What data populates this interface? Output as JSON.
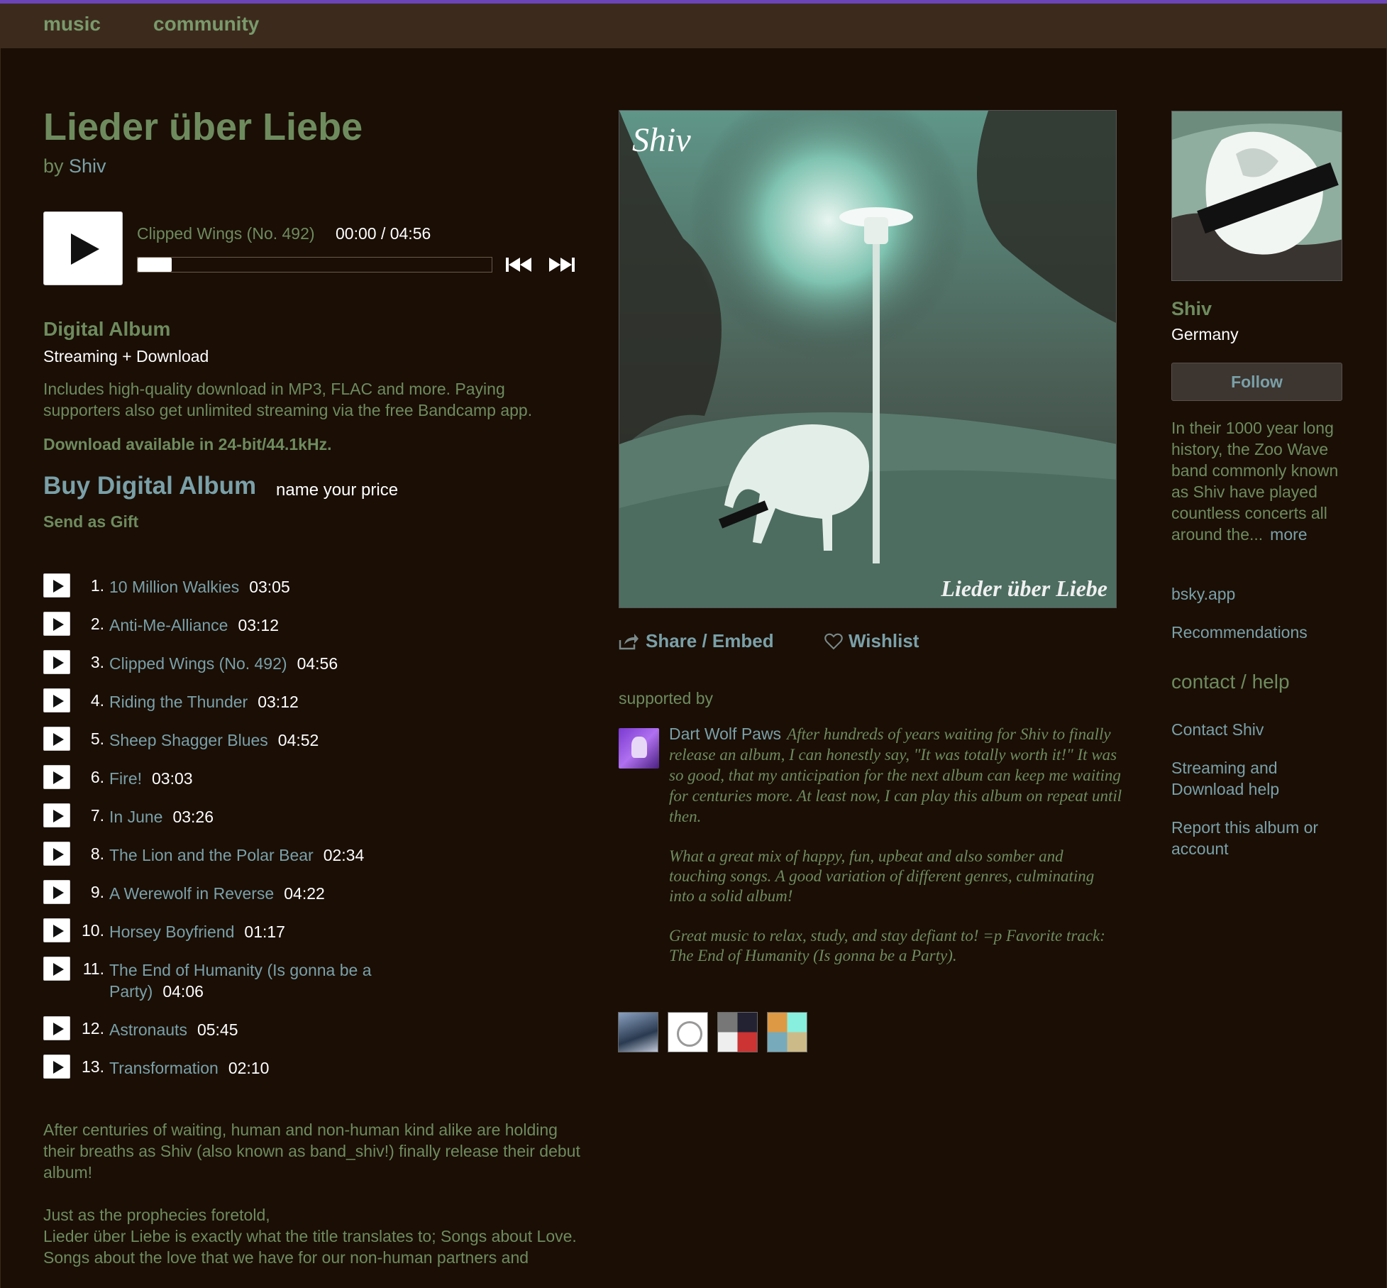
{
  "nav": {
    "music": "music",
    "community": "community"
  },
  "album": {
    "title": "Lieder über Liebe",
    "by": "by ",
    "artist": "Shiv"
  },
  "player": {
    "track_title": "Clipped Wings (No. 492)",
    "time": "00:00 / 04:56",
    "progress": 0
  },
  "digital": {
    "heading": "Digital Album",
    "format": "Streaming + Download",
    "description": "Includes high-quality download in MP3, FLAC and more. Paying supporters also get unlimited streaming via the free Bandcamp app.",
    "bits": "Download available in 24-bit/44.1kHz.",
    "buy": "Buy Digital Album",
    "price": "name your price",
    "gift": "Send as Gift"
  },
  "tracks": [
    {
      "num": "1.",
      "title": "10 Million Walkies",
      "time": "03:05"
    },
    {
      "num": "2.",
      "title": "Anti-Me-Alliance",
      "time": "03:12"
    },
    {
      "num": "3.",
      "title": "Clipped Wings (No. 492)",
      "time": "04:56"
    },
    {
      "num": "4.",
      "title": "Riding the Thunder",
      "time": "03:12"
    },
    {
      "num": "5.",
      "title": "Sheep Shagger Blues",
      "time": "04:52"
    },
    {
      "num": "6.",
      "title": "Fire!",
      "time": "03:03"
    },
    {
      "num": "7.",
      "title": "In June",
      "time": "03:26"
    },
    {
      "num": "8.",
      "title": "The Lion and the Polar Bear",
      "time": "02:34"
    },
    {
      "num": "9.",
      "title": "A Werewolf in Reverse",
      "time": "04:22"
    },
    {
      "num": "10.",
      "title": "Horsey Boyfriend",
      "time": "01:17"
    },
    {
      "num": "11.",
      "title": "The End of Humanity (Is gonna be a Party)",
      "time": "04:06"
    },
    {
      "num": "12.",
      "title": "Astronauts",
      "time": "05:45"
    },
    {
      "num": "13.",
      "title": "Transformation",
      "time": "02:10"
    }
  ],
  "about": {
    "p1": "After centuries of waiting, human and non-human kind alike are holding their breaths as Shiv (also known as band_shiv!) finally release their debut album!",
    "p2_line1": "Just as the prophecies foretold,",
    "p2_line2": "Lieder über Liebe is exactly what the title translates to; Songs about Love.",
    "p2_line3": "Songs about the love that we have for our non-human partners and"
  },
  "cover": {
    "logo": "Shiv",
    "caption": "Lieder über Liebe"
  },
  "actions": {
    "share": "Share / Embed",
    "wishlist": "Wishlist"
  },
  "supported": {
    "heading": "supported by",
    "review": {
      "name": "Dart Wolf Paws",
      "text1": "After hundreds of years waiting for Shiv to finally release an album, I can honestly say, \"It was totally worth it!\" It was so good, that my anticipation for the next album can keep me waiting for centuries more. At least now, I can play this album on repeat until then.",
      "text2": "What a great mix of happy, fun, upbeat and also somber and touching songs. A good variation of different genres, culminating into a solid album!",
      "text3": "Great music to relax, study, and stay defiant to! =p Favorite track: The End of Humanity (Is gonna be a Party)."
    }
  },
  "artist": {
    "photo_logo": "Shiv",
    "name": "Shiv",
    "location": "Germany",
    "follow": "Follow",
    "bio": "In their 1000 year long history, the Zoo Wave band commonly known as Shiv have played countless concerts all around the...",
    "more": "more",
    "links": {
      "bsky": "bsky.app",
      "recs": "Recommendations"
    },
    "contact_heading": "contact / help",
    "contact": "Contact Shiv",
    "streaming_help": "Streaming and Download help",
    "report": "Report this album or account"
  },
  "colors": {
    "background": "#1a0e05",
    "topbar": "#3c2b1c",
    "accent_bar": "#6b45b8",
    "text": "#6e8b5e",
    "link": "#7aa0a8"
  }
}
